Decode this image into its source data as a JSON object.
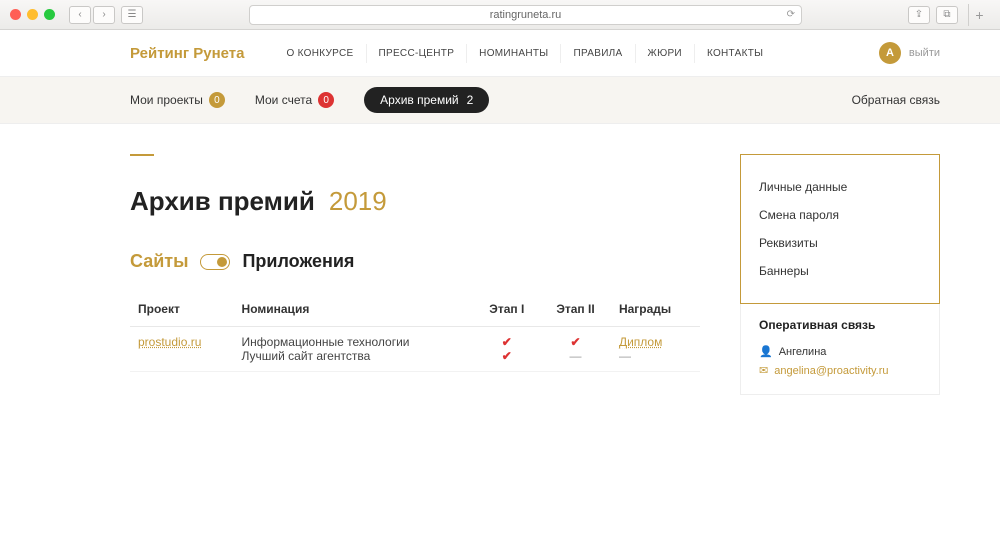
{
  "browser": {
    "url": "ratingruneta.ru"
  },
  "header": {
    "logo": "Рейтинг Рунета",
    "nav": [
      "О КОНКУРСЕ",
      "ПРЕСС-ЦЕНТР",
      "НОМИНАНТЫ",
      "ПРАВИЛА",
      "ЖЮРИ",
      "КОНТАКТЫ"
    ],
    "avatar_letter": "А",
    "logout": "выйти"
  },
  "subbar": {
    "projects_label": "Мои проекты",
    "projects_count": "0",
    "accounts_label": "Мои счета",
    "accounts_count": "0",
    "archive_label": "Архив премий",
    "archive_count": "2",
    "feedback": "Обратная связь"
  },
  "page": {
    "title": "Архив премий",
    "year": "2019",
    "tab_sites": "Сайты",
    "tab_apps": "Приложения"
  },
  "table": {
    "headers": {
      "project": "Проект",
      "nomination": "Номинация",
      "stage1": "Этап I",
      "stage2": "Этап II",
      "awards": "Награды"
    },
    "rows": [
      {
        "project": "prostudio.ru",
        "nominations": [
          {
            "name": "Информационные технологии",
            "s1": "✔",
            "s2": "✔",
            "award": "Диплом"
          },
          {
            "name": "Лучший сайт агентства",
            "s1": "✔",
            "s2": "—",
            "award": "—"
          }
        ]
      }
    ]
  },
  "sidebar": {
    "links": [
      "Личные данные",
      "Смена пароля",
      "Реквизиты",
      "Баннеры"
    ],
    "contact_title": "Оперативная связь",
    "contact_name": "Ангелина",
    "contact_email": "angelina@proactivity.ru"
  }
}
